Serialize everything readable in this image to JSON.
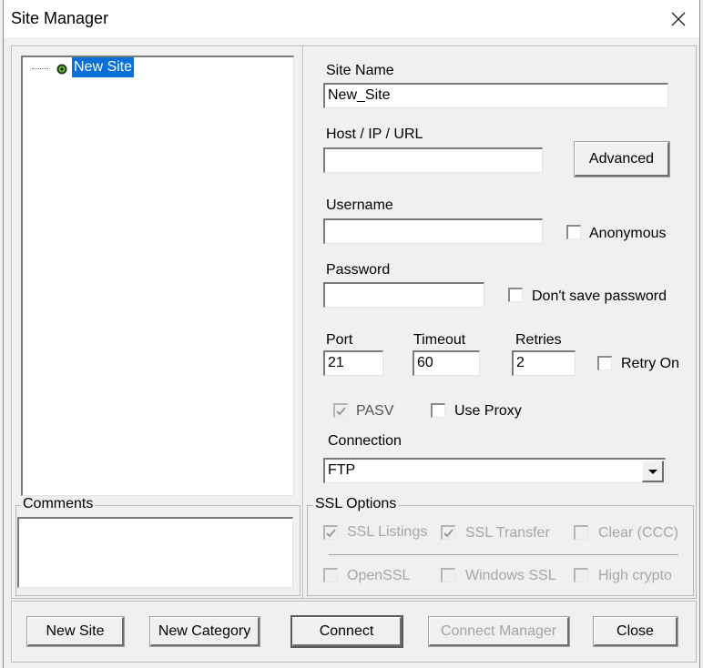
{
  "window": {
    "title": "Site Manager",
    "close_icon": "close-x-icon"
  },
  "tree": {
    "items": [
      {
        "label": "New Site",
        "icon": "site-node-icon",
        "selected": true
      }
    ]
  },
  "form": {
    "site_name": {
      "label": "Site Name",
      "value": "New_Site"
    },
    "host": {
      "label": "Host / IP / URL",
      "value": ""
    },
    "advanced_button": "Advanced",
    "username": {
      "label": "Username",
      "value": ""
    },
    "anonymous": {
      "label": "Anonymous",
      "checked": false
    },
    "password": {
      "label": "Password",
      "value": ""
    },
    "dont_save_password": {
      "label": "Don't save password",
      "checked": false
    },
    "port": {
      "label": "Port",
      "value": "21"
    },
    "timeout": {
      "label": "Timeout",
      "value": "60"
    },
    "retries": {
      "label": "Retries",
      "value": "2"
    },
    "retry_on": {
      "label": "Retry On",
      "checked": false
    },
    "pasv": {
      "label": "PASV",
      "checked": true,
      "disabled": true
    },
    "use_proxy": {
      "label": "Use Proxy",
      "checked": false
    },
    "connection": {
      "label": "Connection",
      "value": "FTP"
    }
  },
  "comments": {
    "label": "Comments",
    "value": ""
  },
  "ssl": {
    "label": "SSL Options",
    "row1": [
      {
        "label": "SSL Listings",
        "checked": true,
        "disabled": true
      },
      {
        "label": "SSL Transfer",
        "checked": true,
        "disabled": true
      },
      {
        "label": "Clear (CCC)",
        "checked": false,
        "disabled": true
      }
    ],
    "row2": [
      {
        "label": "OpenSSL",
        "checked": false,
        "disabled": true
      },
      {
        "label": "Windows SSL",
        "checked": false,
        "disabled": true
      },
      {
        "label": "High crypto",
        "checked": false,
        "disabled": true
      }
    ]
  },
  "buttons": {
    "new_site": "New Site",
    "new_category": "New Category",
    "connect": "Connect",
    "connect_manager": "Connect Manager",
    "close": "Close"
  }
}
